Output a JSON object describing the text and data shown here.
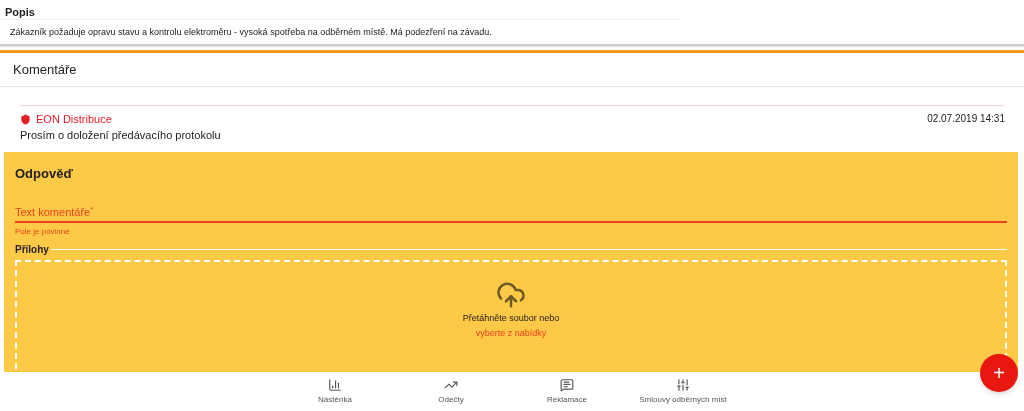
{
  "description": {
    "title": "Popis",
    "text": "Zákazník požaduje opravu stavu a kontrolu elektroměru - vysoká spotřeba na odběrném místě. Má podezření na závadu."
  },
  "comments": {
    "title": "Komentáře",
    "items": [
      {
        "author": "EON Distribuce",
        "date": "02.07.2019 14:31",
        "text": "Prosím o doložení předávacího protokolu"
      }
    ]
  },
  "reply": {
    "title": "Odpověď",
    "field": {
      "placeholder": "Text komentáře",
      "required_mark": "*",
      "error": "Pole je povinné"
    },
    "attachments": {
      "title": "Přílohy",
      "drop_text": "Přetáhněte soubor nebo",
      "browse_link": "vyberte z nabídky"
    }
  },
  "fab": {
    "label": "+"
  },
  "bottom_nav": [
    {
      "kind": "dashboard",
      "label": "Nástěnka"
    },
    {
      "kind": "readings",
      "label": "Odečty"
    },
    {
      "kind": "complaints",
      "label": "Reklamace"
    },
    {
      "kind": "contracts",
      "label": "Smlouvy odběrných míst"
    }
  ]
}
